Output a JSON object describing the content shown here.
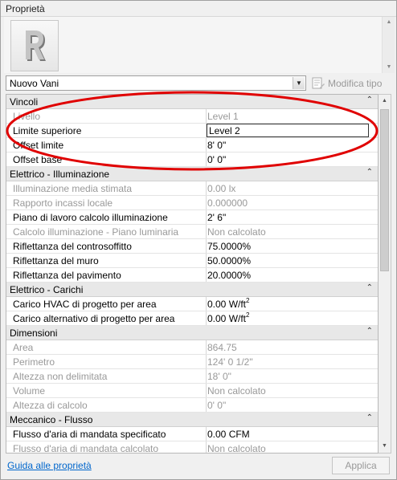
{
  "panel": {
    "title": "Proprietà"
  },
  "preview": {
    "type_icon": "revit-r-icon"
  },
  "type_selector": {
    "selected": "Nuovo Vani"
  },
  "edit_type": {
    "label": "Modifica tipo"
  },
  "groups": [
    {
      "name": "Vincoli",
      "rows": [
        {
          "label": "Livello",
          "value": "Level 1",
          "readonly": true
        },
        {
          "label": "Limite superiore",
          "value": "Level 2",
          "readonly": false,
          "editing": true
        },
        {
          "label": "Offset limite",
          "value": "8'  0\"",
          "readonly": false
        },
        {
          "label": "Offset base",
          "value": "0'  0\"",
          "readonly": false
        }
      ]
    },
    {
      "name": "Elettrico - Illuminazione",
      "rows": [
        {
          "label": "Illuminazione media stimata",
          "value": "0.00 lx",
          "readonly": true
        },
        {
          "label": "Rapporto incassi locale",
          "value": "0.000000",
          "readonly": true
        },
        {
          "label": "Piano di lavoro calcolo illuminazione",
          "value": "2'  6\"",
          "readonly": false
        },
        {
          "label": "Calcolo illuminazione - Piano luminaria",
          "value": "Non calcolato",
          "readonly": true
        },
        {
          "label": "Riflettanza del controsoffitto",
          "value": "75.0000%",
          "readonly": false
        },
        {
          "label": "Riflettanza del muro",
          "value": "50.0000%",
          "readonly": false
        },
        {
          "label": "Riflettanza del pavimento",
          "value": "20.0000%",
          "readonly": false
        }
      ]
    },
    {
      "name": "Elettrico - Carichi",
      "rows": [
        {
          "label": "Carico HVAC di progetto per area",
          "value": "0.00 W/ft",
          "sup": "2",
          "readonly": false
        },
        {
          "label": "Carico alternativo di progetto per area",
          "value": "0.00 W/ft",
          "sup": "2",
          "readonly": false
        }
      ]
    },
    {
      "name": "Dimensioni",
      "rows": [
        {
          "label": "Area",
          "value": "864.75",
          "readonly": true
        },
        {
          "label": "Perimetro",
          "value": "124'  0 1/2\"",
          "readonly": true
        },
        {
          "label": "Altezza non delimitata",
          "value": "18'  0\"",
          "readonly": true
        },
        {
          "label": "Volume",
          "value": "Non calcolato",
          "readonly": true
        },
        {
          "label": "Altezza di calcolo",
          "value": "0'  0\"",
          "readonly": true
        }
      ]
    },
    {
      "name": "Meccanico - Flusso",
      "rows": [
        {
          "label": "Flusso d'aria di mandata specificato",
          "value": "0.00 CFM",
          "readonly": false
        },
        {
          "label": "Flusso d'aria di mandata calcolato",
          "value": "Non calcolato",
          "readonly": true
        }
      ]
    }
  ],
  "footer": {
    "help_link": "Guida alle proprietà",
    "apply_label": "Applica"
  },
  "colors": {
    "annotation": "#e00000",
    "link": "#0066cc",
    "readonly_text": "#999999"
  }
}
